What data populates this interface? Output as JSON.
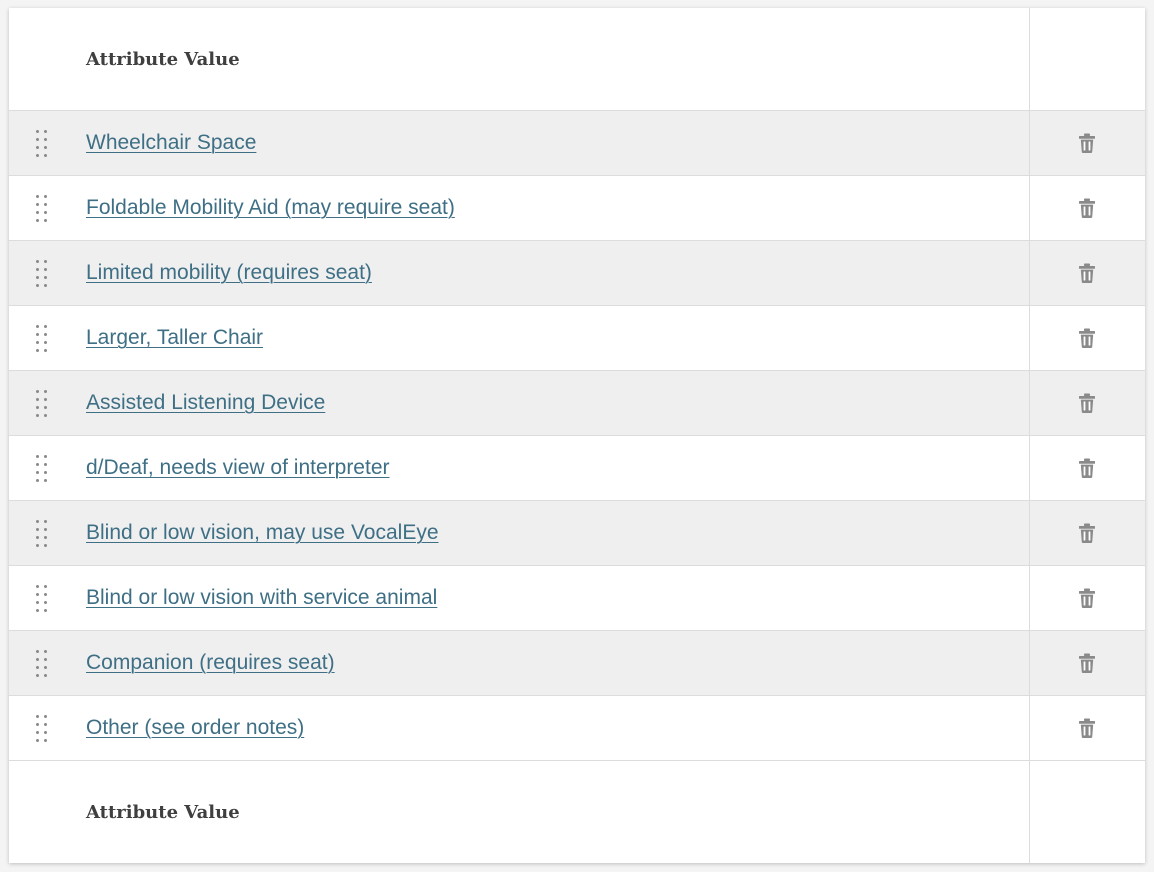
{
  "table": {
    "header_label": "Attribute Value",
    "footer_label": "Attribute Value",
    "rows": [
      {
        "label": "Wheelchair Space"
      },
      {
        "label": "Foldable Mobility Aid (may require seat)"
      },
      {
        "label": "Limited mobility (requires seat)"
      },
      {
        "label": "Larger, Taller Chair"
      },
      {
        "label": "Assisted Listening Device"
      },
      {
        "label": "d/Deaf, needs view of interpreter"
      },
      {
        "label": "Blind or low vision, may use VocalEye"
      },
      {
        "label": "Blind or low vision with service animal"
      },
      {
        "label": "Companion (requires seat)"
      },
      {
        "label": "Other (see order notes)"
      }
    ]
  },
  "icons": {
    "drag": "drag-handle-icon",
    "delete": "trash-icon"
  },
  "colors": {
    "link": "#3e6f85",
    "row_shaded": "#efefef",
    "icon": "#8a8a8a"
  }
}
